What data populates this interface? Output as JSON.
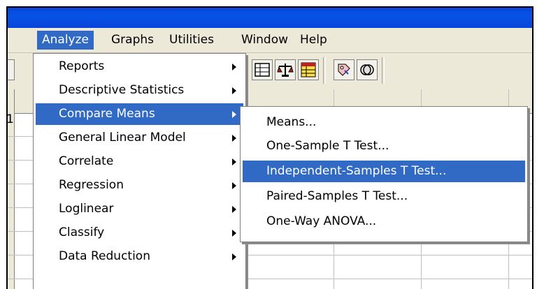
{
  "menubar": {
    "items": [
      "Analyze",
      "Graphs",
      "Utilities",
      "Window",
      "Help"
    ]
  },
  "grid": {
    "visible_case_number": "1"
  },
  "analyze_menu": {
    "items": [
      {
        "label": "Reports",
        "has_submenu": true
      },
      {
        "label": "Descriptive Statistics",
        "has_submenu": true
      },
      {
        "label": "Compare Means",
        "has_submenu": true,
        "highlighted": true
      },
      {
        "label": "General Linear Model",
        "has_submenu": true
      },
      {
        "label": "Correlate",
        "has_submenu": true
      },
      {
        "label": "Regression",
        "has_submenu": true
      },
      {
        "label": "Loglinear",
        "has_submenu": true
      },
      {
        "label": "Classify",
        "has_submenu": true
      },
      {
        "label": "Data Reduction",
        "has_submenu": true
      }
    ]
  },
  "compare_means_submenu": {
    "items": [
      {
        "label": "Means..."
      },
      {
        "label": "One-Sample T Test..."
      },
      {
        "label": "Independent-Samples T Test...",
        "highlighted": true
      },
      {
        "label": "Paired-Samples T Test..."
      },
      {
        "label": "One-Way ANOVA..."
      }
    ]
  },
  "toolbar": {
    "icons": [
      "grid-icon",
      "scale-icon",
      "variable-table-icon",
      "value-labels-icon",
      "use-sets-icon"
    ]
  },
  "colors": {
    "highlight": "#316ac5",
    "titlebar": "#0a44d9",
    "menu_bg": "#ece9d8"
  }
}
